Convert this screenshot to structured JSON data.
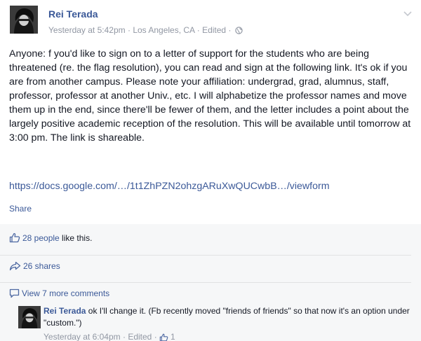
{
  "post": {
    "author": "Rei Terada",
    "timestamp": "Yesterday at 5:42pm",
    "location": "Los Angeles, CA",
    "edited": "Edited",
    "separator": "·",
    "body": "Anyone: f you'd like to sign on to a letter of support for the students who are being threatened (re. the flag resolution), you can read and sign at the following link. It's ok if you are from another campus. Please note your affiliation: undergrad, grad, alumnus, staff, professor, professor at another Univ., etc. I will alphabetize the professor names and move them up in the end, since there'll be fewer of them, and the letter includes a point about the largely positive academic reception of the resolution. This will be available until tomorrow at 3:00 pm. The link is shareable.",
    "link": "https://docs.google.com/…/1t1ZhPZN2ohzgARuXwQUCwbB…/viewform",
    "share_label": "Share",
    "icons": [
      "chevron-down-icon",
      "globe-icon"
    ]
  },
  "ufi": {
    "likes_link": "28 people",
    "likes_suffix": " like this.",
    "shares": "26 shares",
    "view_more": "View 7 more comments",
    "icons": [
      "thumbs-up-icon",
      "share-arrow-icon",
      "comment-icon"
    ]
  },
  "comment": {
    "author": "Rei Terada",
    "text": " ok I'll change it. (Fb recently moved \"friends of friends\" so that now it's an option under \"custom.\")",
    "timestamp": "Yesterday at 6:04pm",
    "edited": "Edited",
    "likes": "1",
    "separator": "·"
  },
  "colors": {
    "link_blue": "#3b5998",
    "meta_gray": "#9197a3",
    "text": "#141823",
    "ufi_bg": "#f6f7f8"
  }
}
